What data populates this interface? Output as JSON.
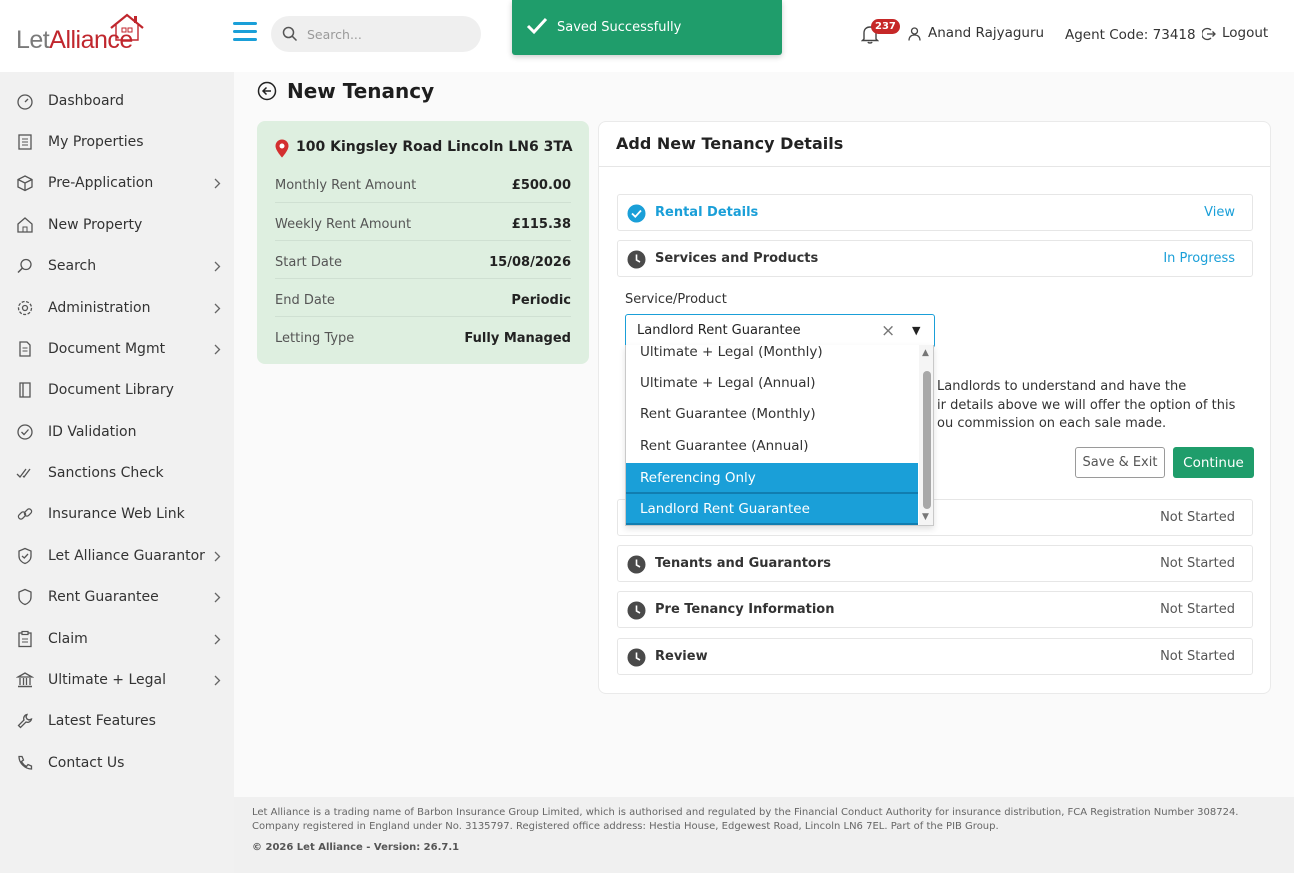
{
  "brand": {
    "logo_let": "Let",
    "logo_alliance": "Alliance"
  },
  "header": {
    "search_placeholder": "Search...",
    "notification_count": "237",
    "user_name": "Anand Rajyaguru",
    "agent_code": "Agent Code: 73418",
    "logout_label": "Logout"
  },
  "toast": {
    "message": "Saved Successfully",
    "color": "#1f9d6b"
  },
  "sidebar": {
    "items": [
      {
        "label": "Dashboard",
        "icon": "dashboard-icon",
        "has_submenu": false
      },
      {
        "label": "My Properties",
        "icon": "building-icon",
        "has_submenu": false
      },
      {
        "label": "Pre-Application",
        "icon": "box-icon",
        "has_submenu": true
      },
      {
        "label": "New Property",
        "icon": "home-icon",
        "has_submenu": false
      },
      {
        "label": "Search",
        "icon": "search-icon",
        "has_submenu": true
      },
      {
        "label": "Administration",
        "icon": "gear-icon",
        "has_submenu": true
      },
      {
        "label": "Document Mgmt",
        "icon": "document-icon",
        "has_submenu": true
      },
      {
        "label": "Document Library",
        "icon": "book-icon",
        "has_submenu": false
      },
      {
        "label": "ID Validation",
        "icon": "check-circle-icon",
        "has_submenu": false
      },
      {
        "label": "Sanctions Check",
        "icon": "double-check-icon",
        "has_submenu": false
      },
      {
        "label": "Insurance Web Link",
        "icon": "link-icon",
        "has_submenu": false
      },
      {
        "label": "Let Alliance Guarantor",
        "icon": "shield-check-icon",
        "has_submenu": true
      },
      {
        "label": "Rent Guarantee",
        "icon": "shield-icon",
        "has_submenu": true
      },
      {
        "label": "Claim",
        "icon": "clipboard-icon",
        "has_submenu": true
      },
      {
        "label": "Ultimate + Legal",
        "icon": "bank-icon",
        "has_submenu": true
      },
      {
        "label": "Latest Features",
        "icon": "wrench-icon",
        "has_submenu": false
      },
      {
        "label": "Contact Us",
        "icon": "phone-icon",
        "has_submenu": false
      }
    ]
  },
  "page": {
    "title": "New Tenancy"
  },
  "property": {
    "address": "100 Kingsley Road Lincoln LN6 3TA",
    "rows": [
      {
        "label": "Monthly Rent Amount",
        "value": "£500.00"
      },
      {
        "label": "Weekly Rent Amount",
        "value": "£115.38"
      },
      {
        "label": "Start Date",
        "value": "15/08/2026"
      },
      {
        "label": "End Date",
        "value": "Periodic"
      },
      {
        "label": "Letting Type",
        "value": "Fully Managed"
      }
    ]
  },
  "details": {
    "title": "Add New Tenancy Details",
    "steps": [
      {
        "name": "Rental Details",
        "status": "View",
        "state": "complete"
      },
      {
        "name": "Services and Products",
        "status": "In Progress",
        "state": "active"
      },
      {
        "name": "",
        "status": "Not Started",
        "state": "pending"
      },
      {
        "name": "Tenants and Guarantors",
        "status": "Not Started",
        "state": "pending"
      },
      {
        "name": "Pre Tenancy Information",
        "status": "Not Started",
        "state": "pending"
      },
      {
        "name": "Review",
        "status": "Not Started",
        "state": "pending"
      }
    ],
    "service_label": "Service/Product",
    "service_value": "Landlord Rent Guarantee",
    "info_lines": [
      "Landlords to understand and have the",
      "ir details above we will offer the option of this",
      "ou commission on each sale made."
    ],
    "save_exit_label": "Save & Exit",
    "continue_label": "Continue"
  },
  "dropdown": {
    "options": [
      {
        "label": "Ultimate + Legal (Monthly)",
        "selected": false
      },
      {
        "label": "Ultimate + Legal (Annual)",
        "selected": false
      },
      {
        "label": "Rent Guarantee (Monthly)",
        "selected": false
      },
      {
        "label": "Rent Guarantee (Annual)",
        "selected": false
      },
      {
        "label": "Referencing Only",
        "selected": true
      },
      {
        "label": "Landlord Rent Guarantee",
        "selected": true
      }
    ]
  },
  "footer": {
    "text": "Let Alliance is a trading name of Barbon Insurance Group Limited, which is authorised and regulated by the Financial Conduct Authority for insurance distribution, FCA Registration Number 308724. Company registered in England under No. 3135797. Registered office address: Hestia House, Edgewest Road, Lincoln LN6 7EL. Part of the PIB Group.",
    "copyright": "© 2026 Let Alliance - Version: 26.7.1"
  },
  "colors": {
    "accent": "#1a9fd8",
    "brand_red": "#c0262d",
    "success": "#1f9d6b",
    "card_green": "#deefe0"
  }
}
